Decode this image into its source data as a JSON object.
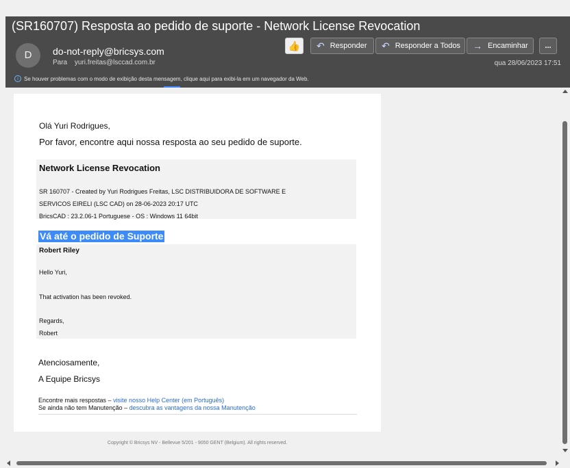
{
  "header": {
    "subject": "(SR160707) Resposta ao pedido de suporte - Network License Revocation",
    "avatar_letter": "D",
    "sender": "do-not-reply@bricsys.com",
    "to_label": "Para",
    "to_address": "yuri.freitas@lsccad.com.br",
    "date": "qua 28/06/2023 17:51",
    "info_bar": "Se houver problemas com o modo de exibição desta mensagem, clique aqui para exibi-la em um navegador da Web.",
    "toolbar": {
      "like_icon": "thumbs-up-icon",
      "reply_label": "Responder",
      "reply_all_label": "Responder a Todos",
      "forward_label": "Encaminhar",
      "more_label": "..."
    }
  },
  "email": {
    "greeting": "Olá Yuri Rodrigues,",
    "intro": "Por favor, encontre aqui nossa resposta ao seu pedido de suporte.",
    "card_title": "Network License Revocation",
    "meta_line1": "SR 160707 - Created by Yuri Rodrigues Freitas, LSC DISTRIBUIDORA DE SOFTWARE E",
    "meta_line2": "SERVICOS EIRELI (LSC CAD) on 28-06-2023 20:17 UTC",
    "meta_line3": "BricsCAD : 23.2.06-1 Portuguese - OS : Windows 11 64bit",
    "go_link": "Vá até o pedido de Suporte",
    "author": "Robert Riley",
    "body": {
      "hello": "Hello Yuri,",
      "line": "That activation has been revoked.",
      "regards": "Regards,",
      "sign": "Robert"
    },
    "closing": "Atenciosamente,",
    "team": "A Equipe Bricsys",
    "more_prefix": "Encontre mais respostas – ",
    "more_link": "visite nosso Help Center (em Português)",
    "maint_prefix": "Se ainda não tem Manutenção – ",
    "maint_link": "descubra as vantagens da nossa Manutenção",
    "copyright": "Copyright © Bricsys NV - Bellevue 5/201 - 9050 GENT (Belgium). All rights reserved."
  },
  "colors": {
    "header_bg": "#4a4a4a",
    "accent": "#3c8bf7",
    "link": "#2a6bd3"
  }
}
